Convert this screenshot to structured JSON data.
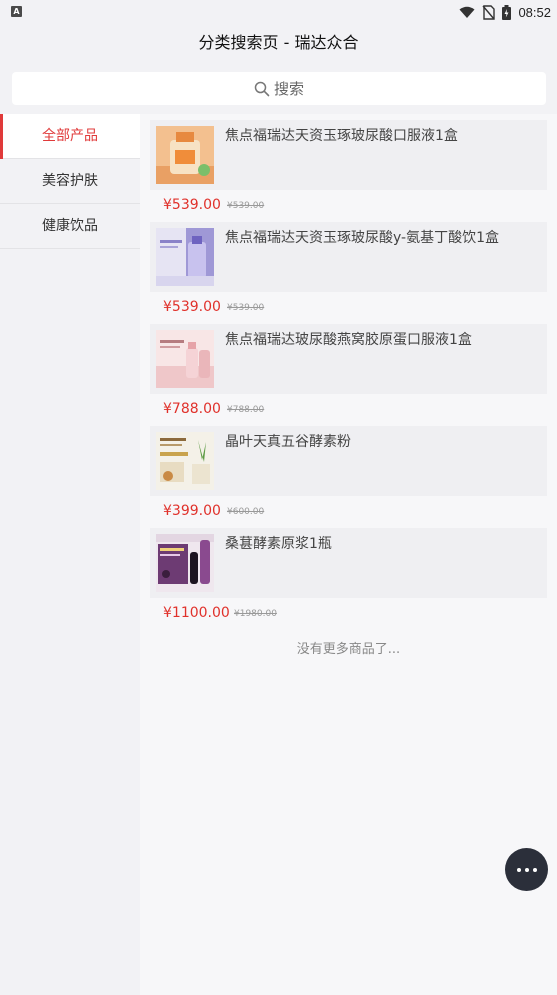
{
  "status_bar": {
    "time": "08:52",
    "left_icon_letter": "A",
    "icons": [
      "wifi-icon",
      "no-sim-icon",
      "battery-icon"
    ]
  },
  "header": {
    "title": "分类搜索页 - 瑞达众合"
  },
  "search": {
    "placeholder": "搜索",
    "icon": "search-icon"
  },
  "sidebar": {
    "items": [
      {
        "label": "全部产品",
        "active": true
      },
      {
        "label": "美容护肤",
        "active": false
      },
      {
        "label": "健康饮品",
        "active": false
      }
    ]
  },
  "products": [
    {
      "name": "焦点福瑞达天资玉琢玻尿酸口服液1盒",
      "price": "¥539.00",
      "original_price": "¥539.00"
    },
    {
      "name": "焦点福瑞达天资玉琢玻尿酸y-氨基丁酸饮1盒",
      "price": "¥539.00",
      "original_price": "¥539.00"
    },
    {
      "name": "焦点福瑞达玻尿酸燕窝胶原蛋口服液1盒",
      "price": "¥788.00",
      "original_price": "¥788.00"
    },
    {
      "name": "晶叶天真五谷酵素粉",
      "price": "¥399.00",
      "original_price": "¥600.00"
    },
    {
      "name": "桑葚酵素原浆1瓶",
      "price": "¥1100.00",
      "original_price": "¥1980.00"
    }
  ],
  "footer": {
    "no_more_text": "没有更多商品了..."
  },
  "colors": {
    "accent": "#e03a3a",
    "price": "#e0312b",
    "background": "#f2f2f5"
  }
}
